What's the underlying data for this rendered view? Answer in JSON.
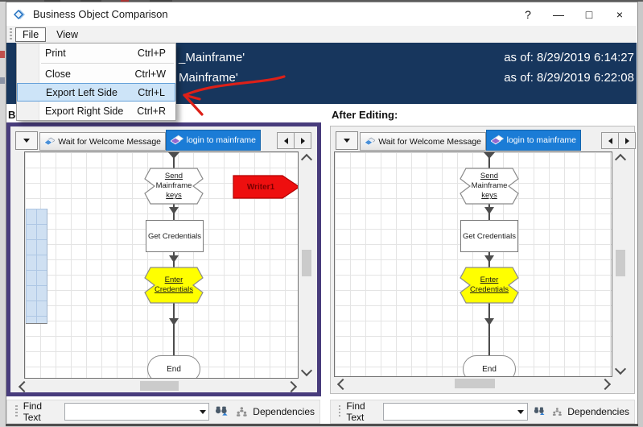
{
  "titlebar": {
    "title": "Business Object Comparison",
    "help": "?",
    "minimize": "—",
    "maximize": "□",
    "close": "×"
  },
  "menubar": {
    "file": "File",
    "view": "View"
  },
  "file_menu": {
    "print": {
      "label": "Print",
      "shortcut": "Ctrl+P"
    },
    "close": {
      "label": "Close",
      "shortcut": "Ctrl+W"
    },
    "export_left": {
      "label": "Export Left Side",
      "shortcut": "Ctrl+L",
      "highlighted": true
    },
    "export_right": {
      "label": "Export Right Side",
      "shortcut": "Ctrl+R"
    }
  },
  "header": {
    "row1": {
      "name_fragment": "_Mainframe'",
      "as_of": "as of: 8/29/2019 6:14:27"
    },
    "row2": {
      "name_fragment": "Mainframe'",
      "as_of": "as of: 8/29/2019 6:22:08"
    }
  },
  "panel_labels": {
    "left": "Before Editing:",
    "right": "After Editing:"
  },
  "tabs": {
    "tab1": "Wait for Welcome Message",
    "tab2": "login to mainframe"
  },
  "flowchart": {
    "send": {
      "line1": "Send",
      "line2": "Mainframe",
      "line3": "keys"
    },
    "get": {
      "label": "Get Credentials"
    },
    "enter": {
      "line1": "Enter",
      "line2": "Credentials"
    },
    "end": {
      "label": "End"
    },
    "writer": {
      "label": "Writer1"
    }
  },
  "findbar": {
    "label": "Find Text",
    "value": "",
    "dependencies": "Dependencies"
  },
  "colors": {
    "header_bg": "#17365D",
    "selected_tab": "#1B7CD6",
    "annotation_purple": "#483C7C",
    "annotation_red": "#DD2018",
    "writer_fill": "#EE0F0F",
    "breakpoint_yellow": "#FFFF00"
  }
}
